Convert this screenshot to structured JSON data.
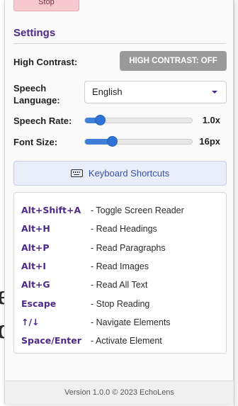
{
  "popup": {
    "stop_label": "Stop",
    "settings_title": "Settings",
    "high_contrast": {
      "label": "High Contrast:",
      "button_label": "HIGH CONTRAST: OFF"
    },
    "speech_language": {
      "label_line1": "Speech",
      "label_line2": "Language:",
      "selected": "English"
    },
    "speech_rate": {
      "label": "Speech Rate:",
      "value_text": "1.0x",
      "level": 0.1
    },
    "font_size": {
      "label": "Font Size:",
      "value_text": "16px",
      "level": 0.23
    },
    "keyboard_shortcuts_button": "Keyboard Shortcuts",
    "shortcuts": [
      {
        "key": "Alt+Shift+A",
        "desc": "- Toggle Screen Reader"
      },
      {
        "key": "Alt+H",
        "desc": "- Read Headings"
      },
      {
        "key": "Alt+P",
        "desc": "- Read Paragraphs"
      },
      {
        "key": "Alt+I",
        "desc": "- Read Images"
      },
      {
        "key": "Alt+G",
        "desc": "- Read All Text"
      },
      {
        "key": "Escape",
        "desc": "- Stop Reading"
      },
      {
        "key": "↑/↓",
        "desc": "- Navigate Elements"
      },
      {
        "key": "Space/Enter",
        "desc": "- Activate Element"
      }
    ],
    "footer": "Version 1.0.0 © 2023 EchoLens"
  },
  "colors": {
    "accent": "#4b2a8a",
    "slider": "#2f72d6",
    "button_gray": "#9a9a9a",
    "kb_button_bg": "#e9edfa"
  },
  "icons": [
    "keyboard-icon",
    "chevron-down-icon"
  ]
}
